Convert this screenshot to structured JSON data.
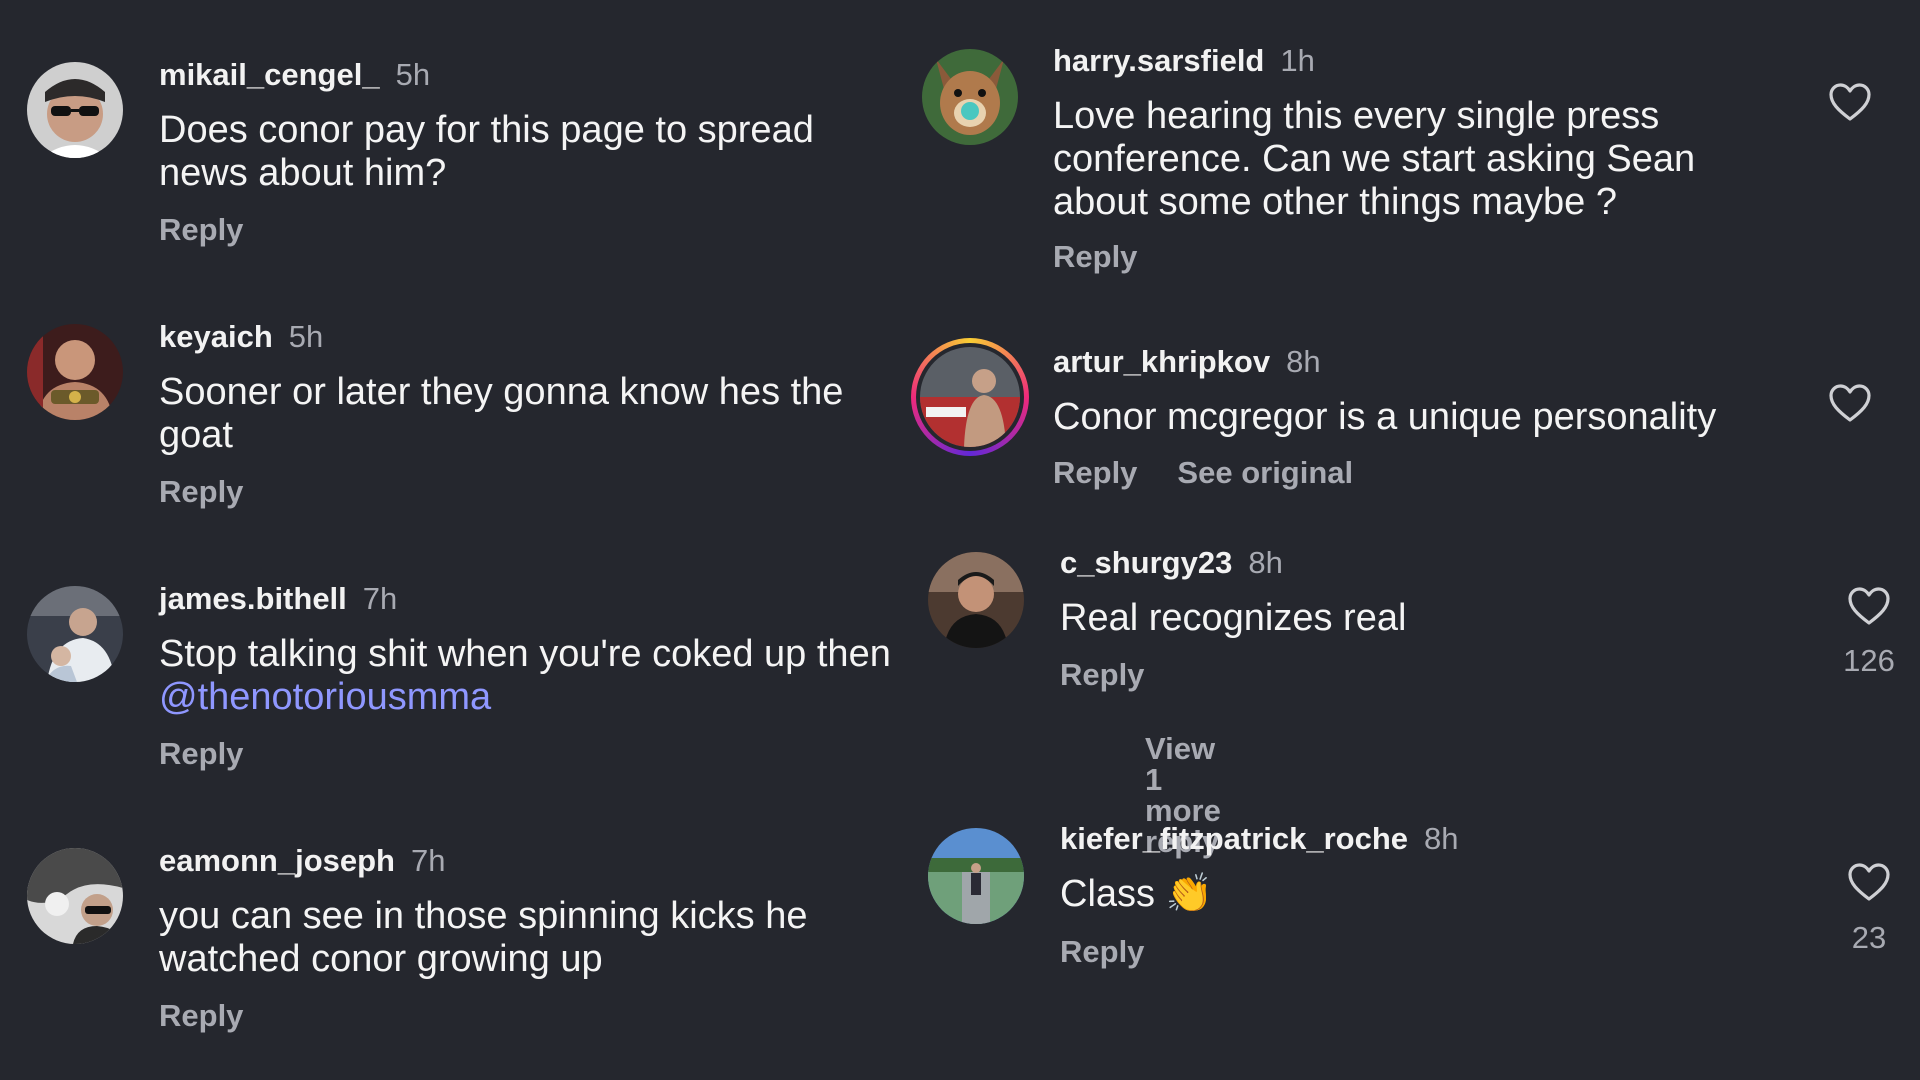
{
  "comments_left": [
    {
      "username": "mikail_cengel_",
      "time": "5h",
      "text": "Does conor pay for this page to spread news about him?",
      "reply": "Reply"
    },
    {
      "username": "keyaich",
      "time": "5h",
      "text": "Sooner or later they gonna know hes the goat",
      "reply": "Reply"
    },
    {
      "username": "james.bithell",
      "time": "7h",
      "text_prefix": "Stop talking shit when you're coked up then",
      "mention": "@thenotoriousmma",
      "reply": "Reply"
    },
    {
      "username": "eamonn_joseph",
      "time": "7h",
      "text": "you can see in those spinning kicks he watched conor growing up",
      "reply": "Reply"
    }
  ],
  "comments_right": [
    {
      "username": "harry.sarsfield",
      "time": "1h",
      "text": "Love hearing this every single press conference. Can we start asking Sean about some other things maybe ?",
      "reply": "Reply"
    },
    {
      "username": "artur_khripkov",
      "time": "8h",
      "text": "Conor mcgregor is a unique personality",
      "reply": "Reply",
      "see_original": "See original"
    },
    {
      "username": "c_shurgy23",
      "time": "8h",
      "text": "Real recognizes real",
      "reply": "Reply",
      "likes": "126",
      "view_more": "View 1 more reply"
    },
    {
      "username": "kiefer_fitzpatrick_roche",
      "time": "8h",
      "text": "Class 👏",
      "reply": "Reply",
      "likes": "23"
    }
  ],
  "colors": {
    "background": "#25272e",
    "text": "#f4f4f4",
    "muted": "#a8aab2",
    "mention": "#8f97ff"
  },
  "icons": [
    "heart-outline-icon"
  ]
}
